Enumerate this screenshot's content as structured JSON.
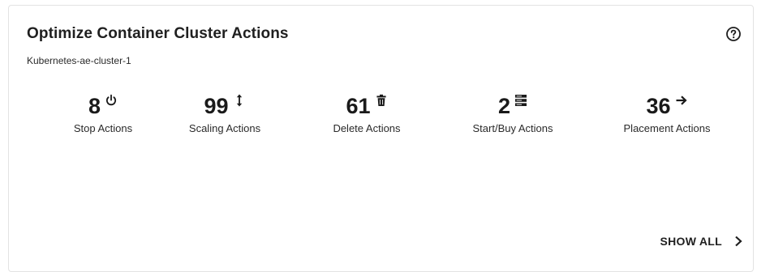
{
  "card": {
    "title": "Optimize Container Cluster Actions",
    "subtitle": "Kubernetes-ae-cluster-1",
    "help_icon": "help-circle-icon"
  },
  "stats": [
    {
      "value": "8",
      "label": "Stop Actions",
      "icon": "power-icon"
    },
    {
      "value": "99",
      "label": "Scaling Actions",
      "icon": "vertical-resize-icon"
    },
    {
      "value": "61",
      "label": "Delete Actions",
      "icon": "trash-icon"
    },
    {
      "value": "2",
      "label": "Start/Buy Actions",
      "icon": "server-stack-icon"
    },
    {
      "value": "36",
      "label": "Placement Actions",
      "icon": "arrow-right-icon"
    }
  ],
  "footer": {
    "show_all_label": "SHOW ALL",
    "chevron_icon": "chevron-right-icon"
  }
}
